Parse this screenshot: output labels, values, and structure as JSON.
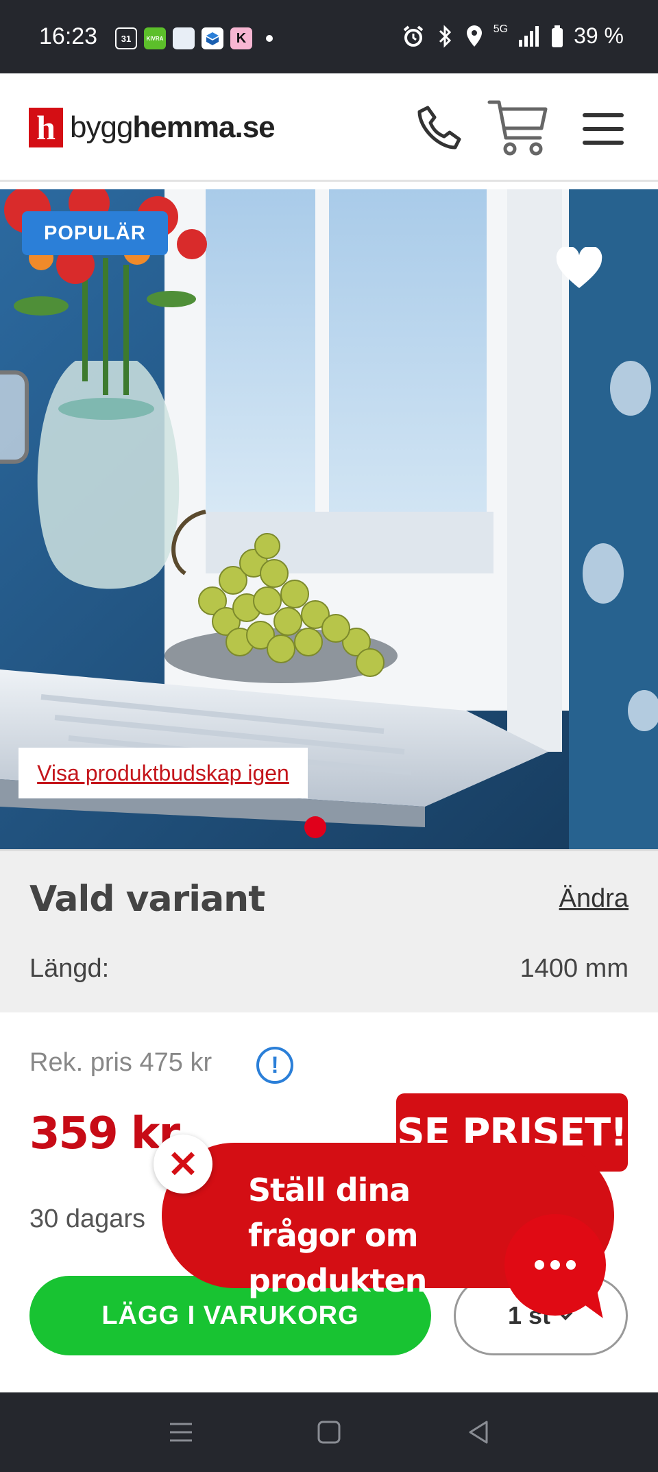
{
  "status_bar": {
    "time": "16:23",
    "battery": "39 %",
    "network": "5G",
    "notification_icons": [
      "calendar-icon",
      "kivra-icon",
      "cloud-app-icon",
      "box-app-icon",
      "klarna-icon"
    ],
    "notification_labels": [
      "31",
      "KIVRA",
      "",
      "",
      "K"
    ]
  },
  "header": {
    "logo_mark": "h",
    "logo_text_light": "bygg",
    "logo_text_bold": "hemma.se"
  },
  "hero": {
    "badge": "POPULÄR",
    "promo_link": "Visa produktbudskap igen",
    "slide_count": 1,
    "active_slide": 1
  },
  "variant": {
    "title": "Vald variant",
    "change_label": "Ändra",
    "attribute_label": "Längd:",
    "attribute_value": "1400 mm"
  },
  "price": {
    "recommended": "Rek. pris 475 kr",
    "info_glyph": "!",
    "current": "359 kr",
    "promo_badge": "SE PRISET!",
    "return_policy": "30 dagars",
    "add_to_cart": "LÄGG I VARUKORG",
    "quantity": "1 st"
  },
  "chat": {
    "message": "Ställ dina frågor om produkten",
    "close_glyph": "✕"
  },
  "colors": {
    "brand_red": "#d40e14",
    "price_red": "#c70b16",
    "cart_green": "#18c332",
    "badge_blue": "#2b7fd8",
    "system_bar": "#25272d"
  }
}
